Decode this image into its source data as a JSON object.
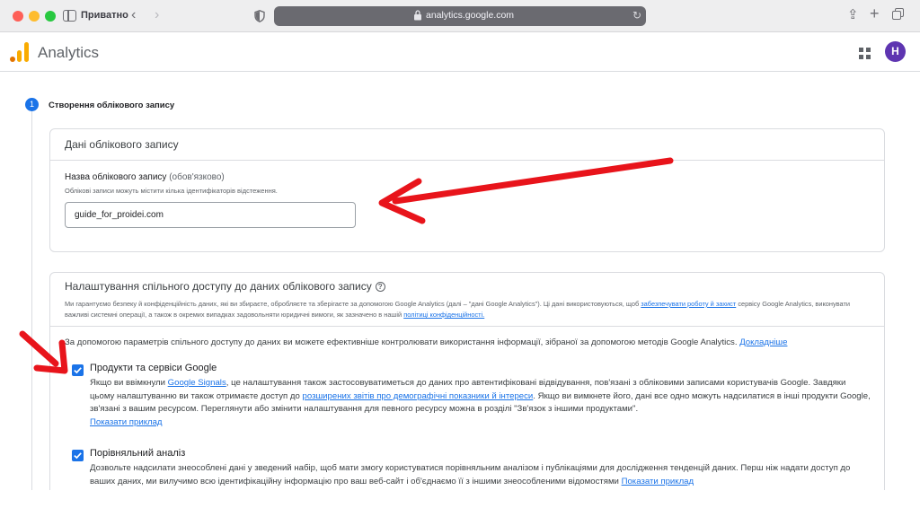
{
  "browser": {
    "private_label": "Приватно",
    "back_glyph": "‹",
    "forward_glyph": "›",
    "url": "analytics.google.com",
    "reload_glyph": "↻",
    "share_glyph": "⇪",
    "plus_glyph": "+"
  },
  "app": {
    "name": "Analytics",
    "avatar_initial": "H",
    "avatar_color": "#5e35b1"
  },
  "step": {
    "number": "1",
    "title": "Створення облікового запису"
  },
  "account_card": {
    "title": "Дані облікового запису",
    "field_label": "Назва облікового запису",
    "field_optional": " (обов'язково)",
    "field_help": "Облікові записи можуть містити кілька ідентифікаторів відстеження.",
    "field_value": "guide_for_proidei.com"
  },
  "sharing_card": {
    "title": "Налаштування спільного доступу до даних облікового запису",
    "help_glyph": "?",
    "intro_1": "Ми гарантуємо безпеку й конфіденційність даних, які ви збираєте, обробляєте та зберігаєте за допомогою Google Analytics (далі – \"дані Google Analytics\"). Ці дані використовуються, щоб ",
    "intro_link_1": "забезпечувати роботу й захист",
    "intro_2": " сервісу Google Analytics, виконувати важливі системні операції, а також в окремих випадках задовольняти юридичні вимоги, як зазначено в нашій ",
    "intro_link_2": "політиці конфіденційності.",
    "lead_text": "За допомогою параметрів спільного доступу до даних ви можете ефективніше контролювати використання інформації, зібраної за допомогою методів Google Analytics. ",
    "lead_link": "Докладніше",
    "options": [
      {
        "title": "Продукти та сервіси Google",
        "checked": true,
        "desc_1": "Якщо ви ввімкнули ",
        "link_1": "Google Signals",
        "desc_2": ", це налаштування також застосовуватиметься до даних про автентифіковані відвідування, пов'язані з обліковими записами користувачів Google. Завдяки цьому налаштуванню ви також отримаєте доступ до ",
        "link_2": "розширених звітів про демографічні показники й інтереси",
        "desc_3": ". Якщо ви вимкнете його, дані все одно можуть надсилатися в інші продукти Google, зв'язані з вашим ресурсом. Переглянути або змінити налаштування для певного ресурсу можна в розділі \"Зв'язок з іншими продуктами\".",
        "example_link": "Показати приклад"
      },
      {
        "title": "Порівняльний аналіз",
        "checked": true,
        "desc_1": "Дозвольте надсилати знеособлені дані у зведений набір, щоб мати змогу користуватися порівняльним аналізом і публікаціями для дослідження тенденцій даних. Перш ніж надати доступ до ваших даних, ми вилучимо всю ідентифікаційну інформацію про ваш веб-сайт і об'єднаємо її з іншими знеособленими відомостями ",
        "example_link": "Показати приклад"
      }
    ]
  },
  "colors": {
    "accent": "#1a73e8",
    "annotation_arrow": "#e8141b"
  }
}
